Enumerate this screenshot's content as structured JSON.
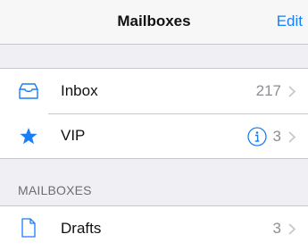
{
  "navbar": {
    "title": "Mailboxes",
    "edit_label": "Edit"
  },
  "group1": {
    "items": [
      {
        "label": "Inbox",
        "count": "217",
        "icon": "inbox-tray-icon"
      },
      {
        "label": "VIP",
        "count": "3",
        "icon": "star-icon",
        "info_icon": "info-icon"
      }
    ]
  },
  "section": {
    "header": "MAILBOXES"
  },
  "group2": {
    "items": [
      {
        "label": "Drafts",
        "count": "3",
        "icon": "document-icon"
      }
    ]
  },
  "colors": {
    "accent": "#1a7ef5",
    "background": "#efeff4",
    "secondary_text": "#8e8e93"
  }
}
